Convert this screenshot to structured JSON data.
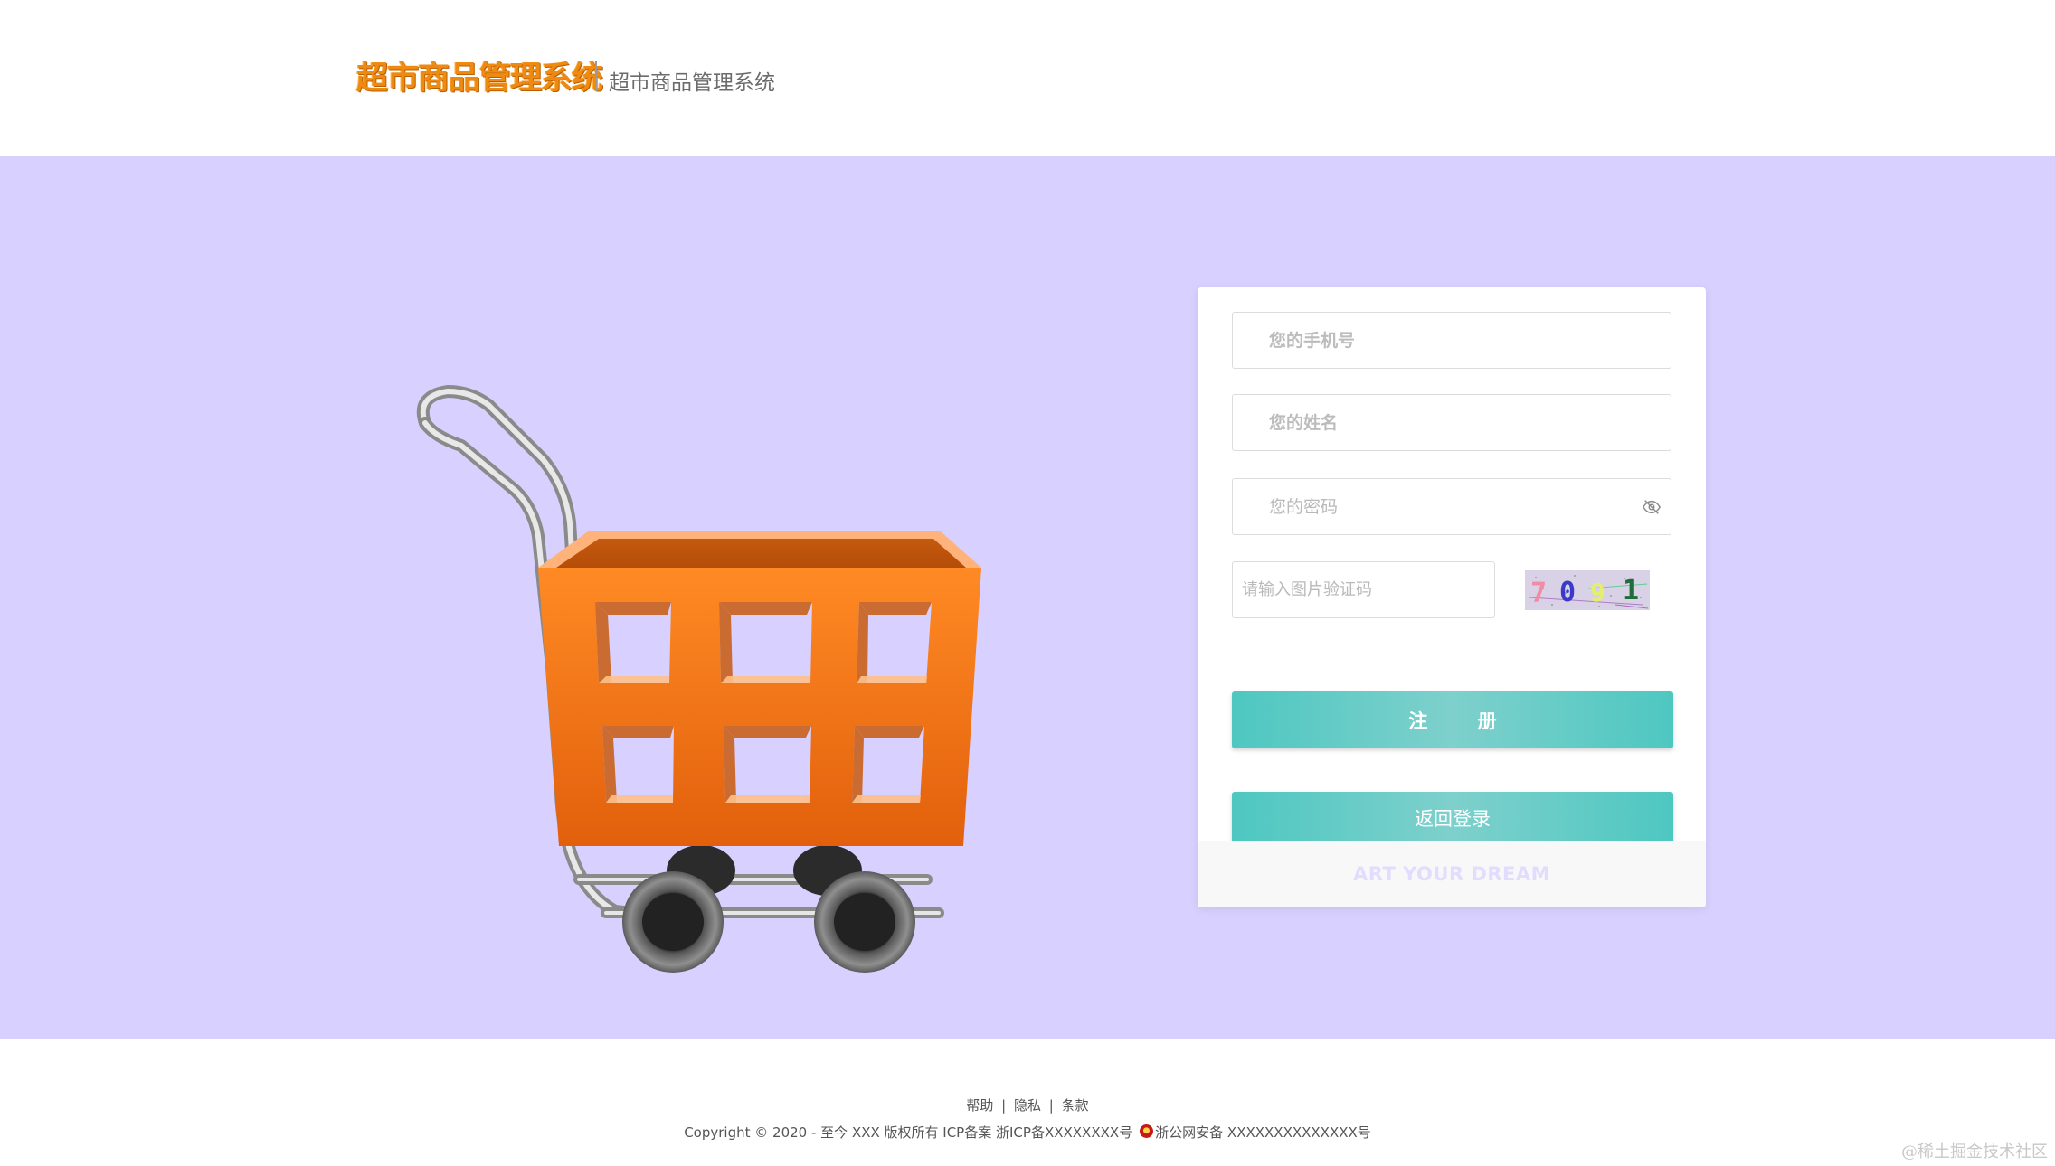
{
  "header": {
    "logo_text": "超市商品管理系统",
    "subtitle": "超市商品管理系统"
  },
  "form": {
    "phone_placeholder": "您的手机号",
    "name_placeholder": "您的姓名",
    "password_placeholder": "您的密码",
    "captcha_placeholder": "请输入图片验证码",
    "captcha_code": "7091",
    "register_button": "注 册",
    "back_to_login_button": "返回登录",
    "slogan": "ART YOUR DREAM"
  },
  "footer": {
    "links": [
      "帮助",
      "隐私",
      "条款"
    ],
    "separator": "|",
    "copyright": "Copyright © 2020 - 至今 XXX 版权所有 ICP备案 浙ICP备XXXXXXXX号",
    "police_record": "浙公网安备 XXXXXXXXXXXXXX号"
  },
  "watermark": "@稀土掘金技术社区",
  "colors": {
    "banner_bg": "#d8d0ff",
    "button": "#4ec7c1",
    "logo": "#ee8a12",
    "cart": "#f57a1c"
  },
  "icons": {
    "password_toggle": "eye-off-icon",
    "police_badge": "police-badge-icon"
  }
}
